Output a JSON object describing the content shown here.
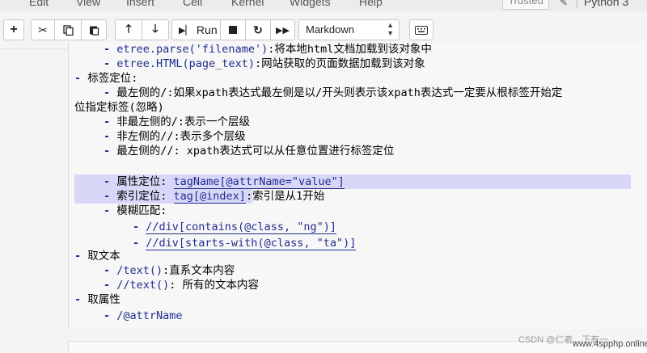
{
  "menu": [
    "Edit",
    "View",
    "Insert",
    "Cell",
    "Kernel",
    "Widgets",
    "Help"
  ],
  "trusted": "Trusted",
  "kernel": "Python 3",
  "toolbar": {
    "run_label": "Run",
    "cell_type": "Markdown"
  },
  "lines": {
    "l1_code": "etree.parse('filename')",
    "l1_text": ":将本地html文档加载到该对象中",
    "l2_code": "etree.HTML(page_text)",
    "l2_text": ":网站获取的页面数据加载到该对象",
    "l3": "标签定位:",
    "l4a": "最左侧的/:如果xpath表达式最左侧是以/开头则表示该xpath表达式一定要从根标签开始定",
    "l4b": "位指定标签(忽略)",
    "l5": "非最左侧的/:表示一个层级",
    "l6": "非左侧的//:表示多个层级",
    "l7": "最左侧的//: xpath表达式可以从任意位置进行标签定位",
    "l8_text": "属性定位: ",
    "l8_code": "tagName[@attrName=\"value\"]",
    "l9_text": "索引定位: ",
    "l9_code": "tag[@index]",
    "l9_rest": ":索引是从1开始",
    "l10": "模糊匹配:",
    "l11": "//div[contains(@class, \"ng\")]",
    "l12": "//div[starts-with(@class, \"ta\")]",
    "l13": "取文本",
    "l14_code": "/text()",
    "l14_text": ":直系文本内容",
    "l15_code": "//text()",
    "l15_text": ": 所有的文本内容",
    "l16": "取属性",
    "l17": "/@attrName"
  },
  "watermark": "CSDN @仁者、下有一",
  "watermark2": "www.4spphp.online"
}
